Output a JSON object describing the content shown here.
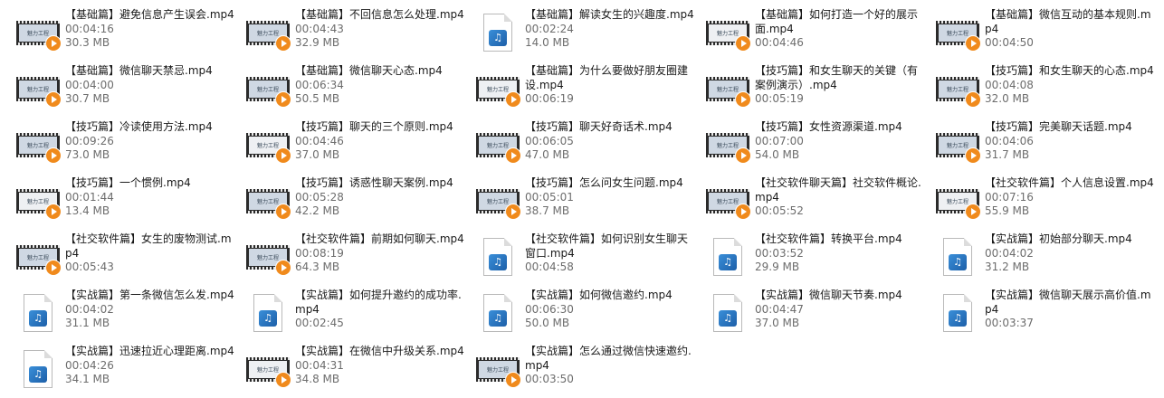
{
  "files": [
    {
      "name": "【基础篇】避免信息产生误会.mp4",
      "duration": "00:04:16",
      "size": "30.3 MB",
      "icon": "video-thumbnail"
    },
    {
      "name": "【基础篇】不回信息怎么处理.mp4",
      "duration": "00:04:43",
      "size": "32.9 MB",
      "icon": "video-thumbnail"
    },
    {
      "name": "【基础篇】解读女生的兴趣度.mp4",
      "duration": "00:02:24",
      "size": "14.0 MB",
      "icon": "media-file-icon"
    },
    {
      "name": "【基础篇】如何打造一个好的展示面.mp4",
      "duration": "00:04:46",
      "size": "",
      "icon": "video-thumbnail"
    },
    {
      "name": "【基础篇】微信互动的基本规则.mp4",
      "duration": "00:04:50",
      "size": "",
      "icon": "video-thumbnail"
    },
    {
      "name": "【基础篇】微信聊天禁忌.mp4",
      "duration": "00:04:00",
      "size": "30.7 MB",
      "icon": "video-thumbnail"
    },
    {
      "name": "【基础篇】微信聊天心态.mp4",
      "duration": "00:06:34",
      "size": "50.5 MB",
      "icon": "video-thumbnail"
    },
    {
      "name": "【基础篇】为什么要做好朋友圈建设.mp4",
      "duration": "00:06:19",
      "size": "",
      "icon": "video-thumbnail"
    },
    {
      "name": "【技巧篇】和女生聊天的关键（有案例演示）.mp4",
      "duration": "00:05:19",
      "size": "",
      "icon": "video-thumbnail"
    },
    {
      "name": "【技巧篇】和女生聊天的心态.mp4",
      "duration": "00:04:08",
      "size": "32.0 MB",
      "icon": "video-thumbnail"
    },
    {
      "name": "【技巧篇】冷读使用方法.mp4",
      "duration": "00:09:26",
      "size": "73.0 MB",
      "icon": "video-thumbnail"
    },
    {
      "name": "【技巧篇】聊天的三个原则.mp4",
      "duration": "00:04:46",
      "size": "37.0 MB",
      "icon": "video-thumbnail"
    },
    {
      "name": "【技巧篇】聊天好奇话术.mp4",
      "duration": "00:06:05",
      "size": "47.0 MB",
      "icon": "video-thumbnail"
    },
    {
      "name": "【技巧篇】女性资源渠道.mp4",
      "duration": "00:07:00",
      "size": "54.0 MB",
      "icon": "video-thumbnail"
    },
    {
      "name": "【技巧篇】完美聊天话题.mp4",
      "duration": "00:04:06",
      "size": "31.7 MB",
      "icon": "video-thumbnail"
    },
    {
      "name": "【技巧篇】一个惯例.mp4",
      "duration": "00:01:44",
      "size": "13.4 MB",
      "icon": "video-thumbnail"
    },
    {
      "name": "【技巧篇】诱惑性聊天案例.mp4",
      "duration": "00:05:28",
      "size": "42.2 MB",
      "icon": "video-thumbnail"
    },
    {
      "name": "【技巧篇】怎么问女生问题.mp4",
      "duration": "00:05:01",
      "size": "38.7 MB",
      "icon": "video-thumbnail"
    },
    {
      "name": "【社交软件聊天篇】社交软件概论.mp4",
      "duration": "00:05:52",
      "size": "",
      "icon": "video-thumbnail"
    },
    {
      "name": "【社交软件篇】个人信息设置.mp4",
      "duration": "00:07:16",
      "size": "55.9 MB",
      "icon": "video-thumbnail"
    },
    {
      "name": "【社交软件篇】女生的废物测试.mp4",
      "duration": "00:05:43",
      "size": "",
      "icon": "video-thumbnail"
    },
    {
      "name": "【社交软件篇】前期如何聊天.mp4",
      "duration": "00:08:19",
      "size": "64.3 MB",
      "icon": "video-thumbnail"
    },
    {
      "name": "【社交软件篇】如何识别女生聊天窗口.mp4",
      "duration": "00:04:58",
      "size": "",
      "icon": "media-file-icon"
    },
    {
      "name": "【社交软件篇】转换平台.mp4",
      "duration": "00:03:52",
      "size": "29.9 MB",
      "icon": "media-file-icon"
    },
    {
      "name": "【实战篇】初始部分聊天.mp4",
      "duration": "00:04:02",
      "size": "31.2 MB",
      "icon": "media-file-icon"
    },
    {
      "name": "【实战篇】第一条微信怎么发.mp4",
      "duration": "00:04:02",
      "size": "31.1 MB",
      "icon": "media-file-icon"
    },
    {
      "name": "【实战篇】如何提升邀约的成功率.mp4",
      "duration": "00:02:45",
      "size": "",
      "icon": "media-file-icon"
    },
    {
      "name": "【实战篇】如何微信邀约.mp4",
      "duration": "00:06:30",
      "size": "50.0 MB",
      "icon": "media-file-icon"
    },
    {
      "name": "【实战篇】微信聊天节奏.mp4",
      "duration": "00:04:47",
      "size": "37.0 MB",
      "icon": "media-file-icon"
    },
    {
      "name": "【实战篇】微信聊天展示高价值.mp4",
      "duration": "00:03:37",
      "size": "",
      "icon": "media-file-icon"
    },
    {
      "name": "【实战篇】迅速拉近心理距离.mp4",
      "duration": "00:04:26",
      "size": "34.1 MB",
      "icon": "media-file-icon"
    },
    {
      "name": "【实战篇】在微信中升级关系.mp4",
      "duration": "00:04:31",
      "size": "34.8 MB",
      "icon": "video-thumbnail"
    },
    {
      "name": "【实战篇】怎么通过微信快速邀约.mp4",
      "duration": "00:03:50",
      "size": "",
      "icon": "video-thumbnail"
    }
  ],
  "thumb_text": "魅力工程"
}
